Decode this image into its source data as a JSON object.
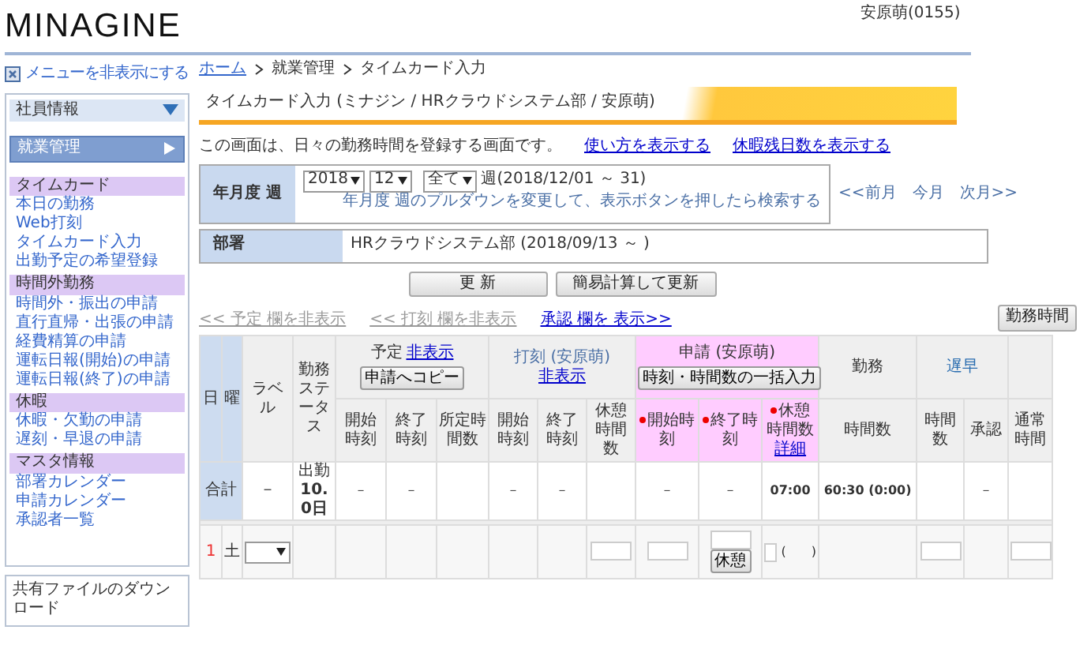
{
  "header": {
    "logo": "MINAGINE",
    "user": "安原萌(0155)"
  },
  "sidebar": {
    "toggle": "メニューを非表示にする",
    "sections": [
      {
        "title": "社員情報",
        "selected": false
      },
      {
        "title": "就業管理",
        "selected": true
      }
    ],
    "groups": [
      {
        "title": "タイムカード",
        "items": [
          "本日の勤務",
          "Web打刻",
          "タイムカード入力",
          "出勤予定の希望登録"
        ]
      },
      {
        "title": "時間外勤務",
        "items": [
          "時間外・振出の申請",
          "直行直帰・出張の申請",
          "経費精算の申請",
          "運転日報(開始)の申請",
          "運転日報(終了)の申請"
        ]
      },
      {
        "title": "休暇",
        "items": [
          "休暇・欠勤の申請",
          "遅刻・早退の申請"
        ]
      },
      {
        "title": "マスタ情報",
        "items": [
          "部署カレンダー",
          "申請カレンダー",
          "承認者一覧"
        ]
      }
    ],
    "download": "共有ファイルのダウンロード"
  },
  "breadcrumb": [
    {
      "text": "ホーム",
      "link": true
    },
    {
      "text": "就業管理",
      "link": false
    },
    {
      "text": "タイムカード入力",
      "link": false
    }
  ],
  "page_title": "タイムカード入力 (ミナジン / HRクラウドシステム部 / 安原萌)",
  "intro": {
    "text": "この画面は、日々の勤務時間を登録する画面です。",
    "links": [
      "使い方を表示する",
      "休暇残日数を表示する"
    ]
  },
  "filter": {
    "label": "年月度 週",
    "year": "2018",
    "month": "12",
    "week": "全て",
    "range": "週(2018/12/01 ～ 31)",
    "hint": "年月度 週のプルダウンを変更して、表示ボタンを押したら検索する",
    "nav": [
      "<<前月",
      "今月",
      "次月>>"
    ],
    "dept_label": "部署",
    "dept": "HRクラウドシステム部 (2018/09/13 ～ )"
  },
  "buttons": [
    "更 新",
    "簡易計算して更新"
  ],
  "column_toggles": [
    {
      "text": "<< 予定 欄を非表示",
      "kind": "muted"
    },
    {
      "text": "<< 打刻 欄を非表示",
      "kind": "muted"
    },
    {
      "text": "承認 欄を 表示>>",
      "kind": "link"
    }
  ],
  "side_button": "勤務時間",
  "table": {
    "day_header": "日",
    "weekday_header": "曜",
    "label_header": "ラベル",
    "status_header": "勤務ステータス",
    "groups": [
      {
        "title": "予定",
        "link": "非表示",
        "button": "申請へコピー",
        "highlight": false,
        "columns": [
          {
            "label": "開始時刻",
            "required": false
          },
          {
            "label": "終了時刻",
            "required": false
          },
          {
            "label": "所定時間数",
            "required": false
          }
        ]
      },
      {
        "title": "打刻 (安原萌)",
        "link": "非表示",
        "highlight": false,
        "columns": [
          {
            "label": "開始時刻",
            "required": false
          },
          {
            "label": "終了時刻",
            "required": false
          },
          {
            "label": "休憩時間数",
            "required": false
          }
        ]
      },
      {
        "title": "申請 (安原萌)",
        "button": "時刻・時間数の一括入力",
        "highlight": true,
        "columns": [
          {
            "label": "開始時刻",
            "required": true
          },
          {
            "label": "終了時刻",
            "required": true
          },
          {
            "label": "休憩時間数",
            "required": true,
            "link": "詳細"
          }
        ]
      },
      {
        "title": "勤務",
        "highlight": false,
        "columns": [
          {
            "label": "時間数",
            "required": false
          }
        ]
      },
      {
        "title": "遅早",
        "highlight": false,
        "columns": [
          {
            "label": "時間数",
            "required": false
          },
          {
            "label": "承認",
            "required": false
          }
        ]
      },
      {
        "highlight": false,
        "columns": [
          {
            "label": "通常時間",
            "required": false
          }
        ]
      }
    ],
    "totals": {
      "label": "合計",
      "label_cell": "－",
      "status": "出勤",
      "days": "10.0日",
      "cells": [
        "－",
        "－",
        "",
        "－",
        "－",
        "",
        "－",
        "－",
        "07:00",
        "60:30 (0:00)",
        "",
        "－",
        ""
      ]
    },
    "rows": [
      {
        "day": "1",
        "weekday": "土",
        "holiday": true,
        "break_button": "休憩",
        "work_note": "(　　)"
      }
    ]
  }
}
